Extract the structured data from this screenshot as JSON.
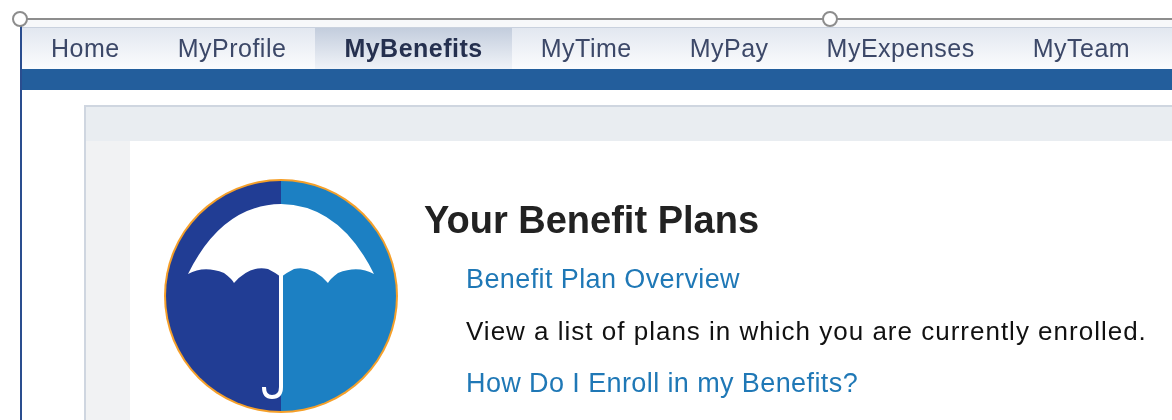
{
  "nav_tabs": [
    {
      "label": "Home",
      "selected": false
    },
    {
      "label": "MyProfile",
      "selected": false
    },
    {
      "label": "MyBenefits",
      "selected": true
    },
    {
      "label": "MyTime",
      "selected": false
    },
    {
      "label": "MyPay",
      "selected": false
    },
    {
      "label": "MyExpenses",
      "selected": false
    },
    {
      "label": "MyTeam",
      "selected": false
    }
  ],
  "benefits": {
    "title": "Your Benefit Plans",
    "items": [
      {
        "kind": "link",
        "text": "Benefit Plan Overview"
      },
      {
        "kind": "description",
        "text": "View a list of plans in which you are currently enrolled."
      },
      {
        "kind": "link",
        "text": "How Do I Enroll in my Benefits?"
      }
    ]
  }
}
